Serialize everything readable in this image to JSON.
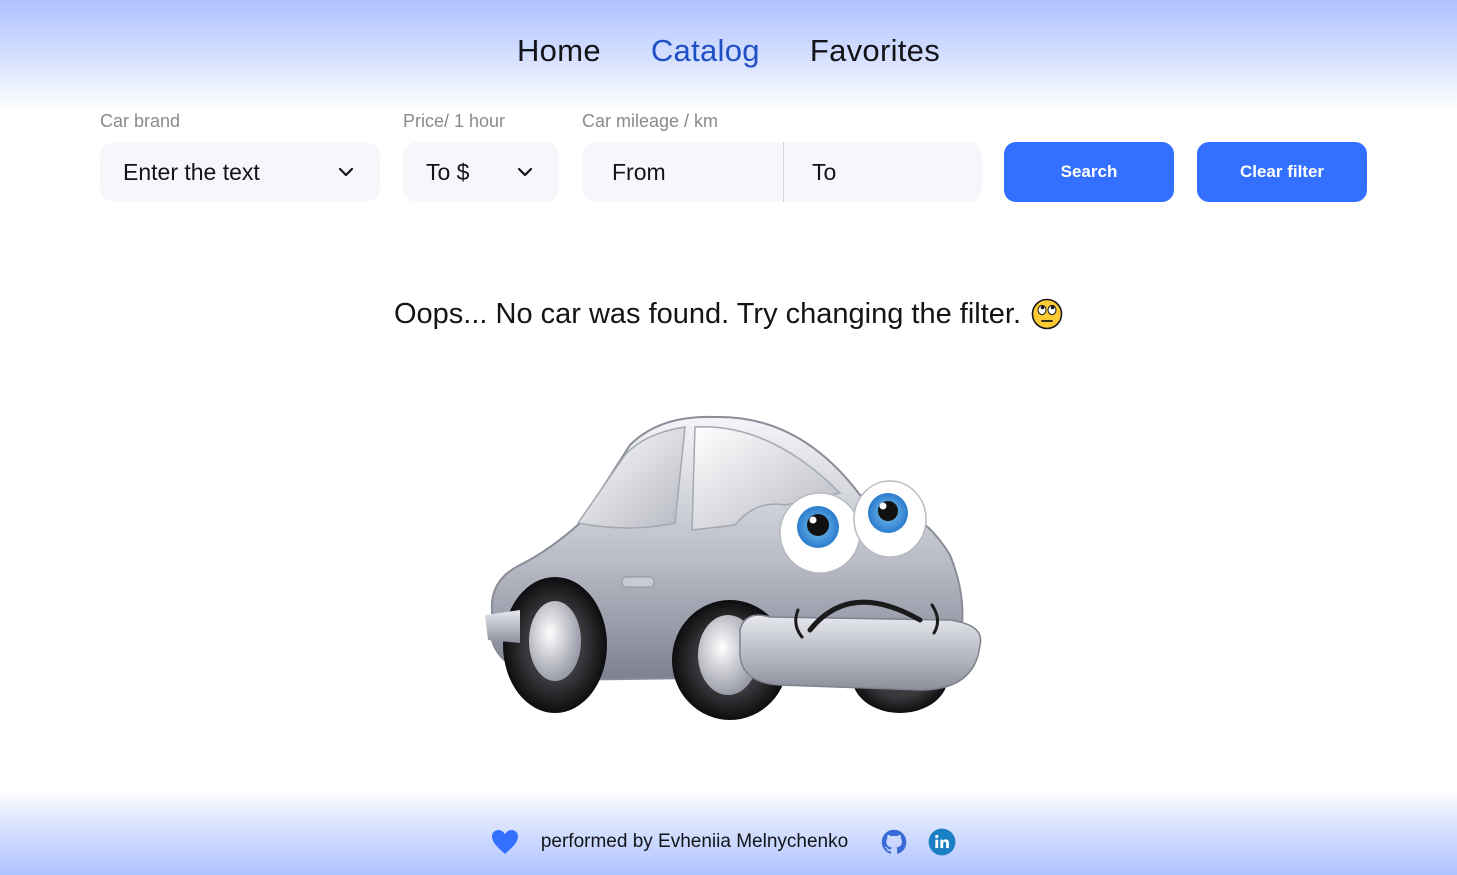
{
  "nav": {
    "items": [
      {
        "label": "Home"
      },
      {
        "label": "Catalog"
      },
      {
        "label": "Favorites"
      }
    ],
    "active": "Catalog"
  },
  "filters": {
    "brand": {
      "label": "Car brand",
      "placeholder": "Enter the text"
    },
    "price": {
      "label": "Price/ 1 hour",
      "placeholder": "To $"
    },
    "mileage": {
      "label": "Car mileage / km",
      "from_placeholder": "From",
      "to_placeholder": "To"
    },
    "search_label": "Search",
    "clear_label": "Clear filter"
  },
  "empty_state": {
    "message": "Oops... No car was found. Try changing the filter.",
    "emoji": "face-with-rolling-eyes-icon",
    "illustration": "sad-car-illustration"
  },
  "footer": {
    "credit": "performed by Evheniia Melnychenko",
    "icons": [
      "heart-icon",
      "github-icon",
      "linkedin-icon"
    ]
  },
  "colors": {
    "accent": "#3470ff",
    "active_nav": "#1f4fc4",
    "field_bg": "#f7f7fb",
    "header_gradient": "#aec2ff",
    "text": "#121417",
    "label": "#8a8a89"
  }
}
